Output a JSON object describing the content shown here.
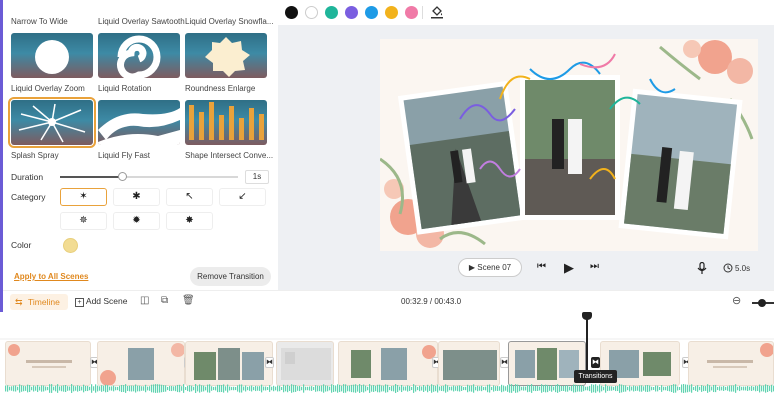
{
  "transitions": {
    "row1_labels": [
      "Narrow To Wide",
      "Liquid Overlay Sawtooth",
      "Liquid Overlay Snowfla..."
    ],
    "row2_labels": [
      "Liquid Overlay Zoom",
      "Liquid Rotation",
      "Roundness Enlarge"
    ],
    "row3_labels": [
      "Splash Spray",
      "Liquid Fly Fast",
      "Shape Intersect Conve..."
    ],
    "selected": "Splash Spray"
  },
  "duration": {
    "label": "Duration",
    "value_text": "1s",
    "level_fraction": 0.35
  },
  "category": {
    "label": "Category",
    "options": [
      "✶",
      "✱",
      "↖",
      "↙",
      "✵",
      "✹",
      "✸"
    ],
    "selected_index": 0
  },
  "color": {
    "label": "Color",
    "value": "#f2dc93"
  },
  "actions": {
    "apply_all": "Apply to All Scenes",
    "remove": "Remove Transition"
  },
  "palette": {
    "colors": [
      "#111111",
      "#ffffff",
      "#1fb59a",
      "#7a5ee0",
      "#1e9be6",
      "#f2b21c",
      "#f07aa7"
    ],
    "fill_icon": "paint-bucket-icon"
  },
  "player": {
    "scene_label": "Scene 07",
    "duration": "5.0s",
    "icons": [
      "play-circle-icon",
      "skip-back-icon",
      "play-icon",
      "skip-forward-icon",
      "microphone-icon",
      "clock-icon"
    ]
  },
  "timeline": {
    "label": "Timeline",
    "add_scene": "Add Scene",
    "time": "00:32.9 / 00:43.0",
    "tooltip": "Transitions",
    "accent": "#e0881e"
  }
}
